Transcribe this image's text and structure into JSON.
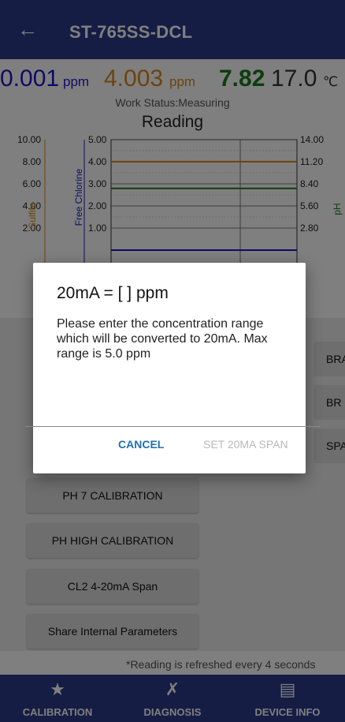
{
  "appbar": {
    "back_icon": "arrow-left-icon",
    "title": "ST-765SS-DCL"
  },
  "readings": {
    "sulfite_value": "0.001",
    "sulfite_unit": "ppm",
    "chlorine_value": "4.003",
    "chlorine_unit": "ppm",
    "ph_value": "7.82",
    "temp_value": "17.0",
    "temp_unit": "℃"
  },
  "work_status": "Work Status:Measuring",
  "chart_data": {
    "type": "line",
    "title": "Reading",
    "left_axis_sulfite": {
      "label": "Sulfite",
      "ticks": [
        "10.00",
        "8.00",
        "6.00",
        "4.00",
        "2.00"
      ]
    },
    "left_axis_chlorine": {
      "label": "Free Chlorine",
      "ticks": [
        "5.00",
        "4.00",
        "3.00",
        "2.00",
        "1.00"
      ]
    },
    "right_axis_ph": {
      "label": "pH",
      "ticks": [
        "14.00",
        "11.20",
        "8.40",
        "5.60",
        "2.80"
      ]
    },
    "series": [
      {
        "color": "#1a7a1a",
        "axis": "ph",
        "value": 7.82
      },
      {
        "color": "#d4891a",
        "axis": "chlorine",
        "value": 4.003
      },
      {
        "color": "#1818c8",
        "axis": "sulfite",
        "value": 0.001
      }
    ]
  },
  "buttons": {
    "right_1": "BRA",
    "right_2": "BR",
    "right_3": "SPA",
    "ph7": "PH 7 CALIBRATION",
    "ph_high": "PH HIGH CALIBRATION",
    "cl2_span": "CL2 4-20mA Span",
    "share": "Share Internal Parameters"
  },
  "refresh_note": "*Reading is refreshed every 4 seconds",
  "bottom_nav": {
    "calibration": {
      "label": "CALIBRATION",
      "icon": "star-icon"
    },
    "diagnosis": {
      "label": "DIAGNOSIS",
      "icon": "tools-icon"
    },
    "device_info": {
      "label": "DEVICE INFO",
      "icon": "document-icon"
    }
  },
  "dialog": {
    "title": "20mA = [    ] ppm",
    "message": "Please enter the concentration range which will be converted to 20mA. Max range is 5.0 ppm",
    "input_value": "",
    "cancel_label": "CANCEL",
    "set_label": "SET 20MA SPAN"
  },
  "colors": {
    "primary": "#2b3b8a",
    "sulfite": "#1818c8",
    "chlorine": "#d4891a",
    "ph": "#1a7a1a",
    "dialog_accent": "#1f6fb2"
  }
}
